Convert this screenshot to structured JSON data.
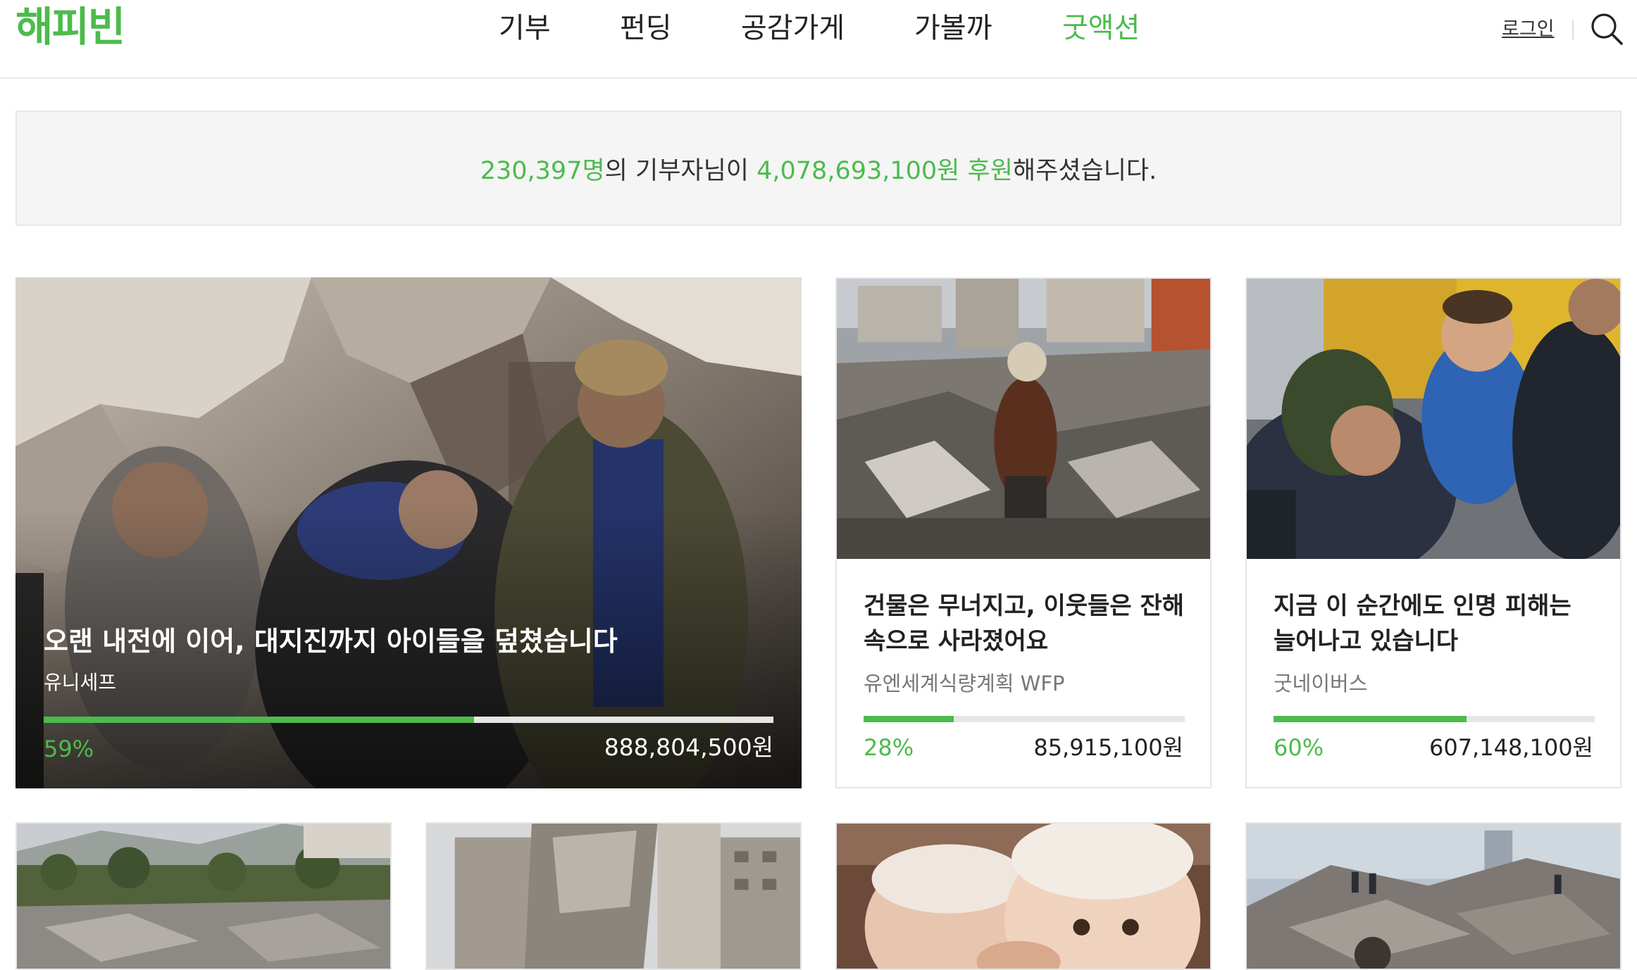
{
  "header": {
    "logo": "해피빈",
    "nav": [
      {
        "label": "기부"
      },
      {
        "label": "펀딩"
      },
      {
        "label": "공감가게"
      },
      {
        "label": "가볼까"
      },
      {
        "label": "굿액션"
      }
    ],
    "active_nav": "굿액션",
    "login": "로그인"
  },
  "stats": {
    "donors": "230,397명",
    "middle": "의 기부자님이 ",
    "amount": "4,078,693,100원 후원",
    "tail": "해주셨습니다."
  },
  "featured": {
    "title": "오랜 내전에 이어, 대지진까지 아이들을 덮쳤습니다",
    "org": "유니세프",
    "percent": "59%",
    "progress": 0.59,
    "amount": "888,804,500원"
  },
  "cards": [
    {
      "title": "건물은 무너지고, 이웃들은 잔해 속으로 사라졌어요",
      "org": "유엔세계식량계획 WFP",
      "percent": "28%",
      "progress": 0.28,
      "amount": "85,915,100원"
    },
    {
      "title": "지금 이 순간에도 인명 피해는 늘어나고 있습니다",
      "org": "굿네이버스",
      "percent": "60%",
      "progress": 0.6,
      "amount": "607,148,100원"
    }
  ],
  "colors": {
    "accent": "#4cbb4c",
    "banner_bg": "#f5f5f5",
    "text": "#222222"
  },
  "icons": {
    "search": "search-icon"
  }
}
